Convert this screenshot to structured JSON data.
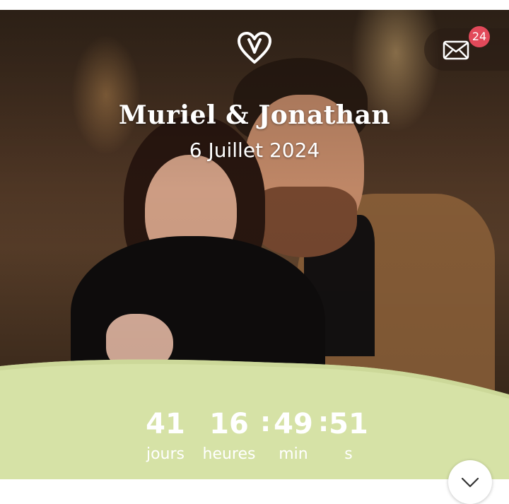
{
  "hero": {
    "title": "Muriel & Jonathan",
    "date": "6 Juillet 2024",
    "logo_icon": "heart-icon"
  },
  "mail": {
    "icon": "envelope-icon",
    "badge_count": "24"
  },
  "countdown": {
    "days": {
      "value": "41",
      "unit": "jours"
    },
    "hours": {
      "value": "16",
      "unit": "heures"
    },
    "minutes": {
      "value": "49",
      "unit": "min"
    },
    "seconds": {
      "value": "51",
      "unit": "s"
    },
    "separator": ":"
  },
  "scroll_button": {
    "icon": "chevron-down-icon"
  },
  "colors": {
    "panel_green": "#d6e2a6",
    "badge_red": "#e2495a",
    "text_white": "#ffffff"
  }
}
